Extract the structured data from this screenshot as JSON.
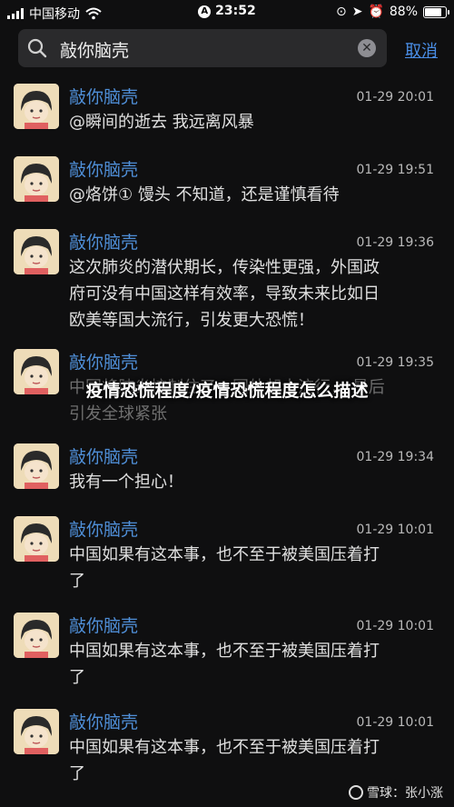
{
  "status": {
    "carrier": "中国移动",
    "time": "23:52",
    "battery": "88%",
    "battery_level": 0.88
  },
  "search": {
    "query": "敲你脑壳",
    "cancel_label": "取消"
  },
  "messages": [
    {
      "name": "敲你脑壳",
      "time": "01-29 20:01",
      "lines": [
        "@瞬间的逝去 我远离风暴"
      ]
    },
    {
      "name": "敲你脑壳",
      "time": "01-29 19:51",
      "lines": [
        "@烙饼① 馒头 不知道，还是谨慎看待"
      ]
    },
    {
      "name": "敲你脑壳",
      "time": "01-29 19:36",
      "lines": [
        "这次肺炎的潜伏期长，传染性更强，外国政",
        "府可没有中国这样有效率，导致未来比如日",
        "欧美等国大流行，引发更大恐慌！"
      ]
    },
    {
      "name": "敲你脑壳",
      "time": "01-29 19:35",
      "lines": [
        "中国将肺炎控制住了，国外却大流行，  最后",
        "引发全球紧张"
      ]
    },
    {
      "name": "敲你脑壳",
      "time": "01-29 19:34",
      "lines": [
        "我有一个担心！"
      ]
    },
    {
      "name": "敲你脑壳",
      "time": "01-29 10:01",
      "lines": [
        "中国如果有这本事，也不至于被美国压着打",
        "了"
      ]
    },
    {
      "name": "敲你脑壳",
      "time": "01-29 10:01",
      "lines": [
        "中国如果有这本事，也不至于被美国压着打",
        "了"
      ]
    },
    {
      "name": "敲你脑壳",
      "time": "01-29 10:01",
      "lines": [
        "中国如果有这本事，也不至于被美国压着打",
        "了"
      ]
    }
  ],
  "overlay_title": "疫情恐慌程度/疫情恐慌程度怎么描述",
  "watermark": "雪球：张小涨",
  "icons": {
    "search": "search-icon",
    "clear": "clear-icon",
    "avatar": "avatar-icon",
    "wifi": "wifi-icon",
    "location": "location-icon",
    "alarm": "alarm-icon",
    "lock": "lock-icon"
  },
  "colors": {
    "background": "#0f0f10",
    "name": "#4f8fd8",
    "link": "#4a8ee6"
  }
}
